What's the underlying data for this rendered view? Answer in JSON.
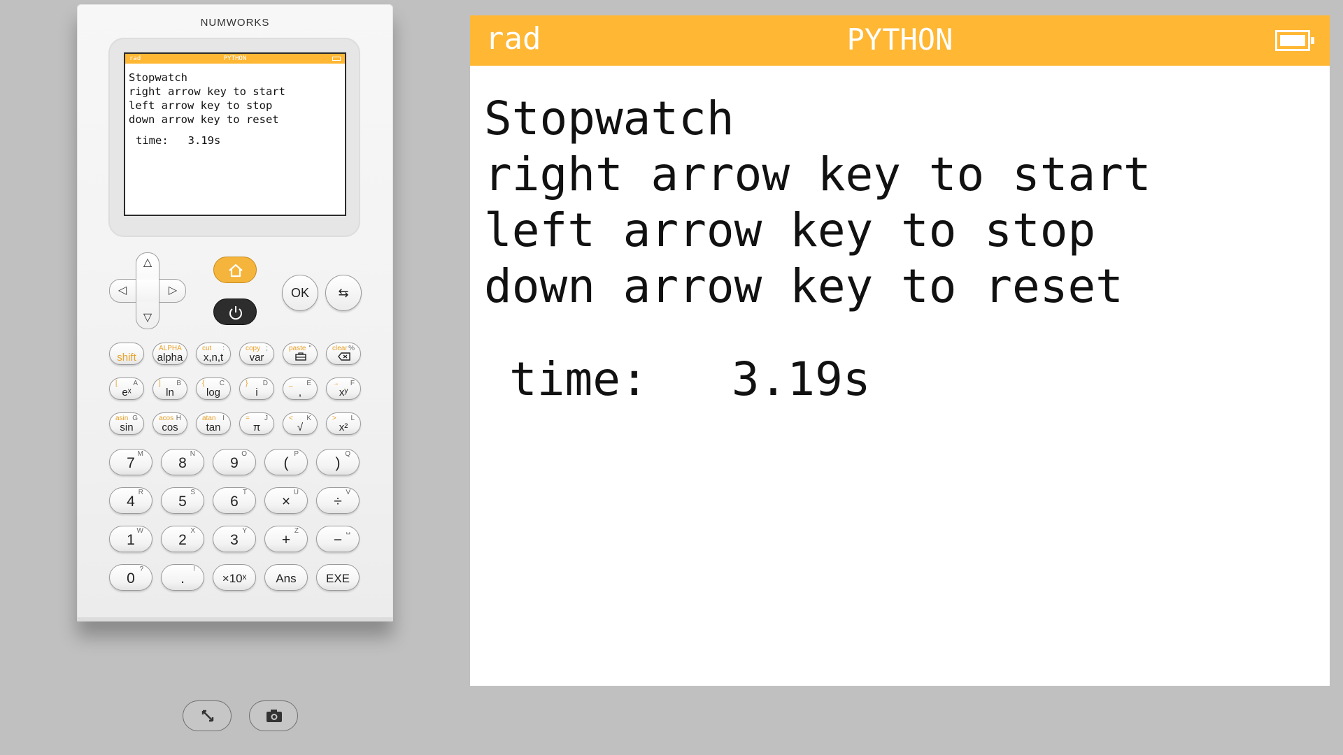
{
  "calculator": {
    "brand": "NUMWORKS",
    "status_bar": {
      "angle_mode": "rad",
      "app": "PYTHON",
      "battery_icon": "battery-full-icon"
    },
    "console_lines": [
      "Stopwatch",
      "right arrow key to start",
      "left arrow key to stop",
      "down arrow key to reset"
    ],
    "time_label": "time:",
    "time_value": "3.19s",
    "nav": {
      "up": "△",
      "down": "▽",
      "left": "◁",
      "right": "▷",
      "ok": "OK",
      "back": "⇆",
      "home_icon": "home-icon",
      "power_icon": "power-icon"
    },
    "function_keys": [
      {
        "main": "shift",
        "sub": "",
        "alpha": ""
      },
      {
        "main": "alpha",
        "sub": "ALPHA",
        "alpha": ""
      },
      {
        "main": "x,n,t",
        "sub": "cut",
        "alpha": ":"
      },
      {
        "main": "var",
        "sub": "copy",
        "alpha": ";"
      },
      {
        "main": "",
        "sub": "paste",
        "alpha": "\""
      },
      {
        "main": "",
        "sub": "clear",
        "alpha": "%"
      },
      {
        "main": "eˣ",
        "sub": "[",
        "alpha": "A"
      },
      {
        "main": "ln",
        "sub": "]",
        "alpha": "B"
      },
      {
        "main": "log",
        "sub": "{",
        "alpha": "C"
      },
      {
        "main": "i",
        "sub": "}",
        "alpha": "D"
      },
      {
        "main": ",",
        "sub": "_",
        "alpha": "E"
      },
      {
        "main": "xʸ",
        "sub": "→",
        "alpha": "F"
      },
      {
        "main": "sin",
        "sub": "asin",
        "alpha": "G"
      },
      {
        "main": "cos",
        "sub": "acos",
        "alpha": "H"
      },
      {
        "main": "tan",
        "sub": "atan",
        "alpha": "I"
      },
      {
        "main": "π",
        "sub": "=",
        "alpha": "J"
      },
      {
        "main": "√",
        "sub": "<",
        "alpha": "K"
      },
      {
        "main": "x²",
        "sub": ">",
        "alpha": "L"
      }
    ],
    "number_keys": [
      {
        "main": "7",
        "alpha": "M"
      },
      {
        "main": "8",
        "alpha": "N"
      },
      {
        "main": "9",
        "alpha": "O"
      },
      {
        "main": "(",
        "alpha": "P"
      },
      {
        "main": ")",
        "alpha": "Q"
      },
      {
        "main": "4",
        "alpha": "R"
      },
      {
        "main": "5",
        "alpha": "S"
      },
      {
        "main": "6",
        "alpha": "T"
      },
      {
        "main": "×",
        "alpha": "U"
      },
      {
        "main": "÷",
        "alpha": "V"
      },
      {
        "main": "1",
        "alpha": "W"
      },
      {
        "main": "2",
        "alpha": "X"
      },
      {
        "main": "3",
        "alpha": "Y"
      },
      {
        "main": "+",
        "alpha": "Z"
      },
      {
        "main": "−",
        "alpha": "␣"
      },
      {
        "main": "0",
        "alpha": "?"
      },
      {
        "main": ".",
        "alpha": "!"
      },
      {
        "main": "×10ˣ",
        "alpha": ""
      },
      {
        "main": "Ans",
        "alpha": ""
      },
      {
        "main": "EXE",
        "alpha": ""
      }
    ]
  },
  "toolbar": {
    "fullscreen_icon": "fullscreen-icon",
    "screenshot_icon": "camera-icon"
  },
  "screen": {
    "angle_mode": "rad",
    "app": "PYTHON",
    "console_lines": [
      "Stopwatch",
      "right arrow key to start",
      "left arrow key to stop",
      "down arrow key to reset"
    ],
    "time_label": "time:",
    "time_value": "3.19s"
  },
  "colors": {
    "accent": "#ffb734",
    "background": "#c0c0c0",
    "home_key": "#f5b43b",
    "power_key": "#2d2d2d"
  }
}
